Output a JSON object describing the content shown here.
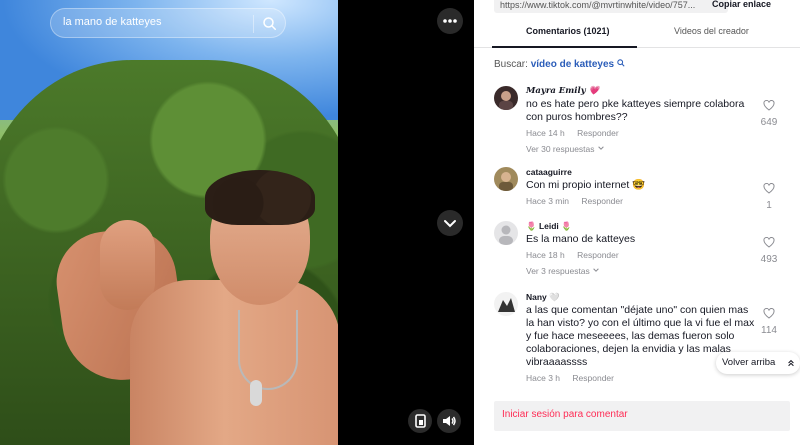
{
  "video": {
    "search_text": "la mano de katteyes"
  },
  "url_bar": {
    "url": "https://www.tiktok.com/@mvrtinwhite/video/757...",
    "copy_label": "Copiar enlace"
  },
  "tabs": [
    {
      "label": "Comentarios (1021)",
      "active": true
    },
    {
      "label": "Videos del creador",
      "active": false
    }
  ],
  "search_row": {
    "prefix": "Buscar:",
    "link": "vídeo de katteyes"
  },
  "comments": [
    {
      "user": "Mayra Emily 💗",
      "text": "no es hate pero pke katteyes siempre colabora con puros hombres??",
      "time": "Hace 14 h",
      "reply": "Responder",
      "likes": "649",
      "replies": "Ver 30 respuestas"
    },
    {
      "user": "cataaguirre",
      "text": "Con mi propio internet 🤓",
      "time": "Hace 3 min",
      "reply": "Responder",
      "likes": "1",
      "replies": ""
    },
    {
      "user": "🌷 Leidi 🌷",
      "text": "Es la mano de katteyes",
      "time": "Hace 18 h",
      "reply": "Responder",
      "likes": "493",
      "replies": "Ver 3 respuestas"
    },
    {
      "user": "Nany 🤍",
      "text": "a las que comentan \"déjate uno\" con quien mas la han visto? yo con el último que la vi fue el max y fue hace meseeees, las demas fueron solo colaboraciones, dejen la envidia y las malas vibraaaassss",
      "time": "Hace 3 h",
      "reply": "Responder",
      "likes": "114",
      "replies": ""
    }
  ],
  "volver_label": "Volver arriba",
  "login_label": "Iniciar sesión para comentar",
  "colors": {
    "accent": "#fe2c55",
    "link": "#2b5db9"
  }
}
